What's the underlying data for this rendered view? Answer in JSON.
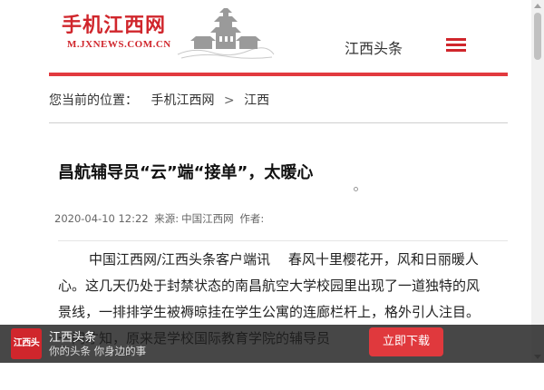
{
  "header": {
    "logo_title": "手机江西网",
    "logo_url": "M.JXNEWS.COM.CN",
    "channel": "江西头条",
    "accent_color": "#d0262c"
  },
  "breadcrumb": {
    "prefix": "您当前的位置：",
    "items": [
      "手机江西网",
      "江西"
    ],
    "separator": ">"
  },
  "article": {
    "title": "昌航辅导员“云”端“接单”，太暖心",
    "date": "2020-04-10 12:22",
    "source_label": "来源:",
    "source": "中国江西网",
    "author_label": "作者:",
    "author": "",
    "body": "中国江西网/江西头条客户端讯　 春风十里樱花开，风和日丽暖人心。这几天仍处于封禁状态的南昌航空大学校园里出现了一道独特的风景线，一排排学生被褥晾挂在学生公寓的连廊栏杆上，格外引人注目。一问才知，原来是学校国际教育学院的辅导员"
  },
  "app_banner": {
    "logo_text": "江西头条",
    "name": "江西头条",
    "slogan": "你的头条 你身边的事",
    "download_label": "立即下载"
  }
}
